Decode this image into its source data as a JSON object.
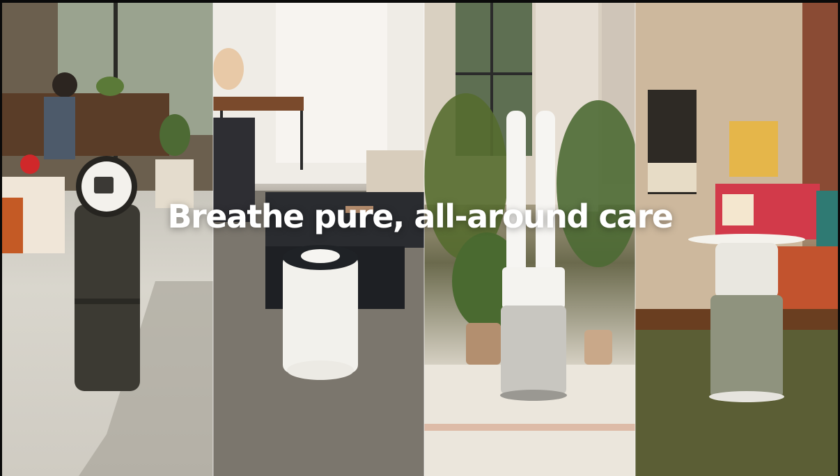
{
  "headline": "Breathe pure, all-around care",
  "scenes": [
    {
      "name": "living-room-tower-purifier",
      "accent": "#3a3a30"
    },
    {
      "name": "lounge-compact-purifier",
      "accent": "#f2f2ee"
    },
    {
      "name": "plant-room-tower-fan",
      "accent": "#efefeb"
    },
    {
      "name": "retro-room-table-purifier",
      "accent": "#8f937e"
    }
  ]
}
